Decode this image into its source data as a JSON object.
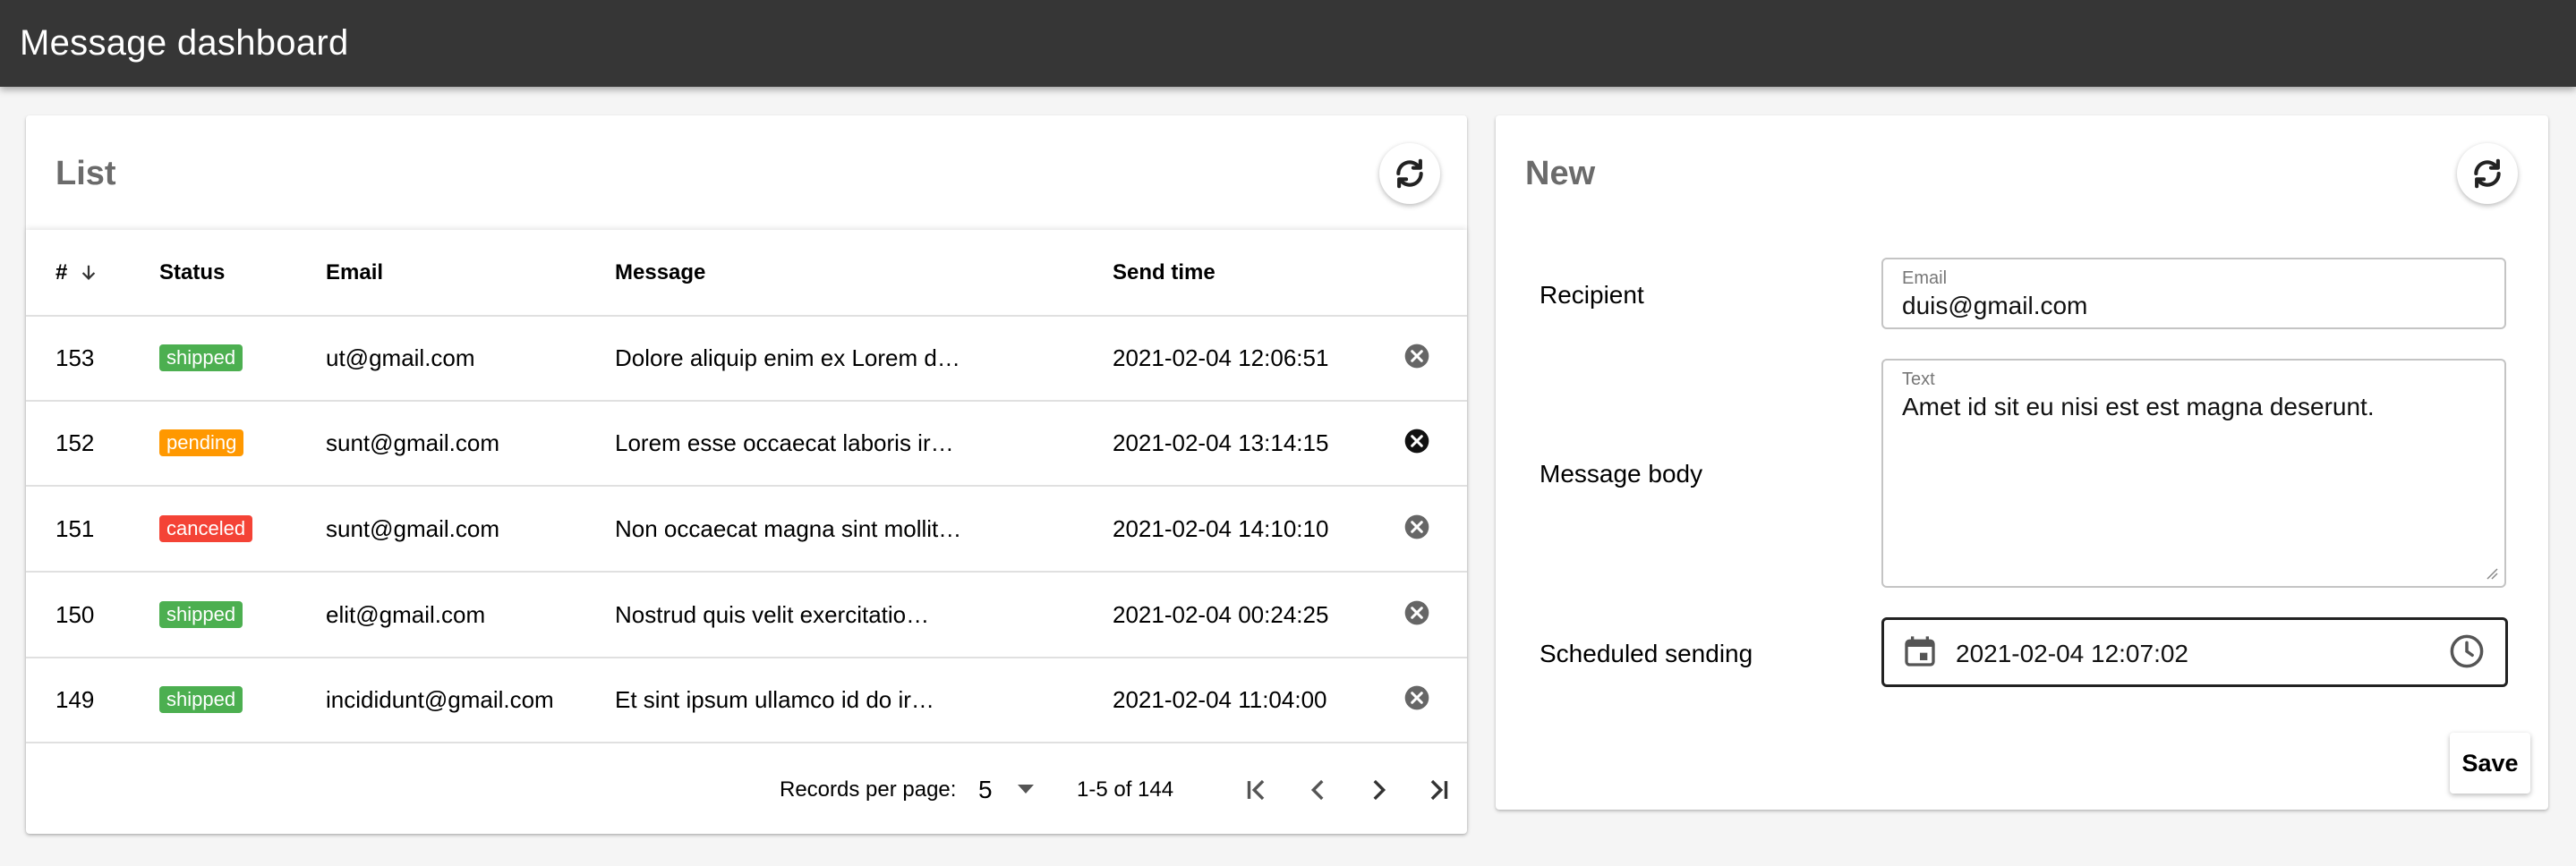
{
  "app": {
    "title": "Message dashboard"
  },
  "list": {
    "title": "List",
    "refresh_icon": "refresh-icon",
    "columns": [
      "#",
      "Status",
      "Email",
      "Message",
      "Send time"
    ],
    "sort_icon": "arrow-down-icon",
    "rows": [
      {
        "id": "153",
        "status": "shipped",
        "email": "ut@gmail.com",
        "message": "Dolore aliquip enim ex Lorem d…",
        "time": "2021-02-04 12:06:51"
      },
      {
        "id": "152",
        "status": "pending",
        "email": "sunt@gmail.com",
        "message": "Lorem esse occaecat laboris ir…",
        "time": "2021-02-04 13:14:15"
      },
      {
        "id": "151",
        "status": "canceled",
        "email": "sunt@gmail.com",
        "message": "Non occaecat magna sint mollit…",
        "time": "2021-02-04 14:10:10"
      },
      {
        "id": "150",
        "status": "shipped",
        "email": "elit@gmail.com",
        "message": "Nostrud quis velit exercitatio…",
        "time": "2021-02-04 00:24:25"
      },
      {
        "id": "149",
        "status": "shipped",
        "email": "incididunt@gmail.com",
        "message": "Et sint ipsum ullamco id do ir…",
        "time": "2021-02-04 11:04:00"
      }
    ],
    "pagination": {
      "records_label": "Records per page:",
      "per_page": "5",
      "range": "1-5 of 144"
    }
  },
  "new": {
    "title": "New",
    "recipient_label": "Recipient",
    "email_field_label": "Email",
    "email_value": "duis@gmail.com",
    "body_label": "Message body",
    "text_field_label": "Text",
    "text_value": "Amet id sit eu nisi est est magna deserunt.",
    "schedule_label": "Scheduled sending",
    "schedule_value": "2021-02-04 12:07:02",
    "save_label": "Save"
  },
  "colors": {
    "appbar": "#363636",
    "shipped": "#4caf50",
    "pending": "#ff9800",
    "canceled": "#f44336"
  }
}
